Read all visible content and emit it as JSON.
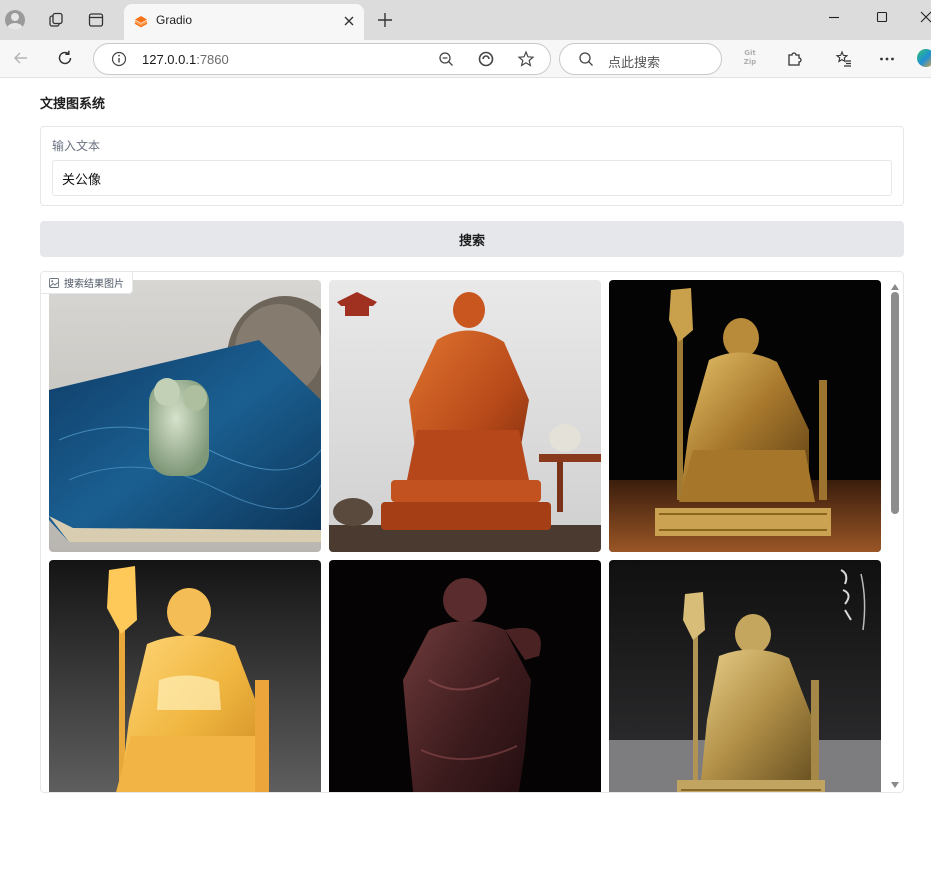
{
  "browser": {
    "tab": {
      "title": "Gradio"
    },
    "address": {
      "host": "127.0.0.1",
      "port": ":7860"
    },
    "search": {
      "placeholder": "点此搜索"
    },
    "extension_label": "Git Zip"
  },
  "app": {
    "title": "文搜图系统",
    "input": {
      "label": "输入文本",
      "value": "关公像"
    },
    "search_button": "搜索",
    "gallery": {
      "label": "搜索结果图片",
      "items": [
        {
          "subject": "jade carving on blue cloth"
        },
        {
          "subject": "red rosewood Guan Gong statue"
        },
        {
          "subject": "bronze seated Guan Gong statue"
        },
        {
          "subject": "golden Guan Gong statue"
        },
        {
          "subject": "dark wood Guan Gong figure"
        },
        {
          "subject": "brass seated Guan Gong statue"
        }
      ]
    },
    "accent_colors": {
      "button_bg": "#e5e7eb",
      "border": "#e5e7eb",
      "scroll_thumb": "#8d8d8d"
    }
  }
}
